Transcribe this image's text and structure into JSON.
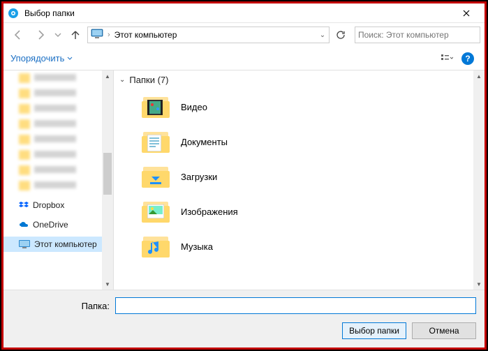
{
  "window": {
    "title": "Выбор папки"
  },
  "nav": {
    "breadcrumb": "Этот компьютер",
    "search_placeholder": "Поиск: Этот компьютер"
  },
  "toolbar": {
    "organize": "Упорядочить"
  },
  "sidebar": {
    "items": [
      {
        "label": "",
        "blurred": true
      },
      {
        "label": "",
        "blurred": true
      },
      {
        "label": "",
        "blurred": true
      },
      {
        "label": "",
        "blurred": true
      },
      {
        "label": "",
        "blurred": true
      },
      {
        "label": "",
        "blurred": true
      },
      {
        "label": "",
        "blurred": true
      },
      {
        "label": "",
        "blurred": true
      },
      {
        "label": "Dropbox",
        "icon": "dropbox"
      },
      {
        "label": "OneDrive",
        "icon": "onedrive"
      },
      {
        "label": "Этот компьютер",
        "icon": "pc",
        "selected": true
      }
    ]
  },
  "main": {
    "group_header": "Папки (7)",
    "folders": [
      {
        "label": "Видео",
        "overlay": "video"
      },
      {
        "label": "Документы",
        "overlay": "doc"
      },
      {
        "label": "Загрузки",
        "overlay": "download"
      },
      {
        "label": "Изображения",
        "overlay": "image"
      },
      {
        "label": "Музыка",
        "overlay": "music"
      }
    ]
  },
  "bottom": {
    "folder_label": "Папка:",
    "folder_value": "",
    "select_button": "Выбор папки",
    "cancel_button": "Отмена"
  }
}
